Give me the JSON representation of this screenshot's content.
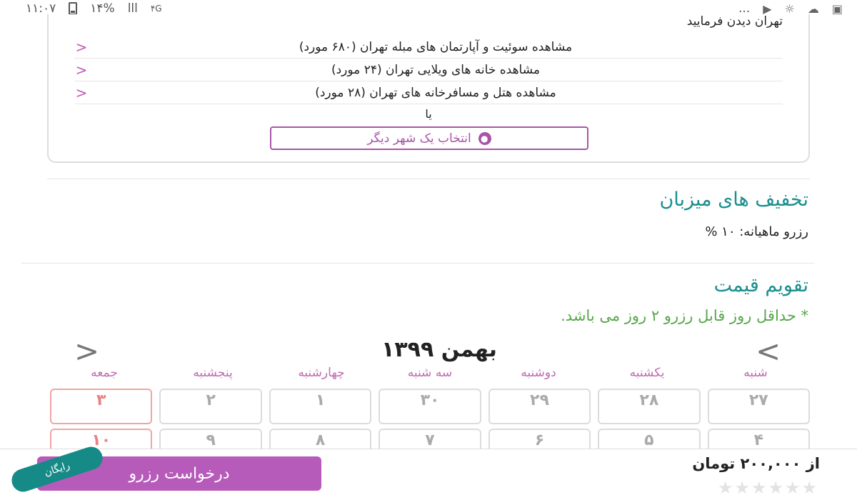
{
  "status_bar": {
    "time": "۱۱:۰۷",
    "battery": "۱۴%",
    "signal": "ااا",
    "lte": "۴G",
    "dots": "..."
  },
  "city_card": {
    "head": "تهران دیدن فرمایید",
    "links": [
      "مشاهده سوئیت و آپارتمان های مبله تهران (۶۸۰ مورد)",
      "مشاهده خانه های ویلایی تهران (۲۴ مورد)",
      "مشاهده هتل و مسافرخانه های تهران (۲۸ مورد)"
    ],
    "or_label": "یا",
    "choose_city_label": "انتخاب یک شهر دیگر"
  },
  "discounts": {
    "title": "تخفیف های میزبان",
    "monthly": "رزرو ماهیانه: ۱۰ %"
  },
  "calendar": {
    "title": "تقویم قیمت",
    "note": "* حداقل روز قابل رزرو ۲ روز می باشد.",
    "month": "بهمن ۱۳۹۹",
    "weekdays": [
      "شنبه",
      "یکشنبه",
      "دوشنبه",
      "سه شنبه",
      "چهارشنبه",
      "پنجشنبه",
      "جمعه"
    ],
    "rows": [
      [
        "۲۷",
        "۲۸",
        "۲۹",
        "۳۰",
        "۱",
        "۲",
        "۳"
      ],
      [
        "۴",
        "۵",
        "۶",
        "۷",
        "۸",
        "۹",
        "۱۰"
      ]
    ]
  },
  "footer": {
    "price": "از ۲۰۰,۰۰۰ تومان",
    "reserve_label": "درخواست رزرو",
    "free_badge": "رایگان",
    "rating_stars": 0
  }
}
